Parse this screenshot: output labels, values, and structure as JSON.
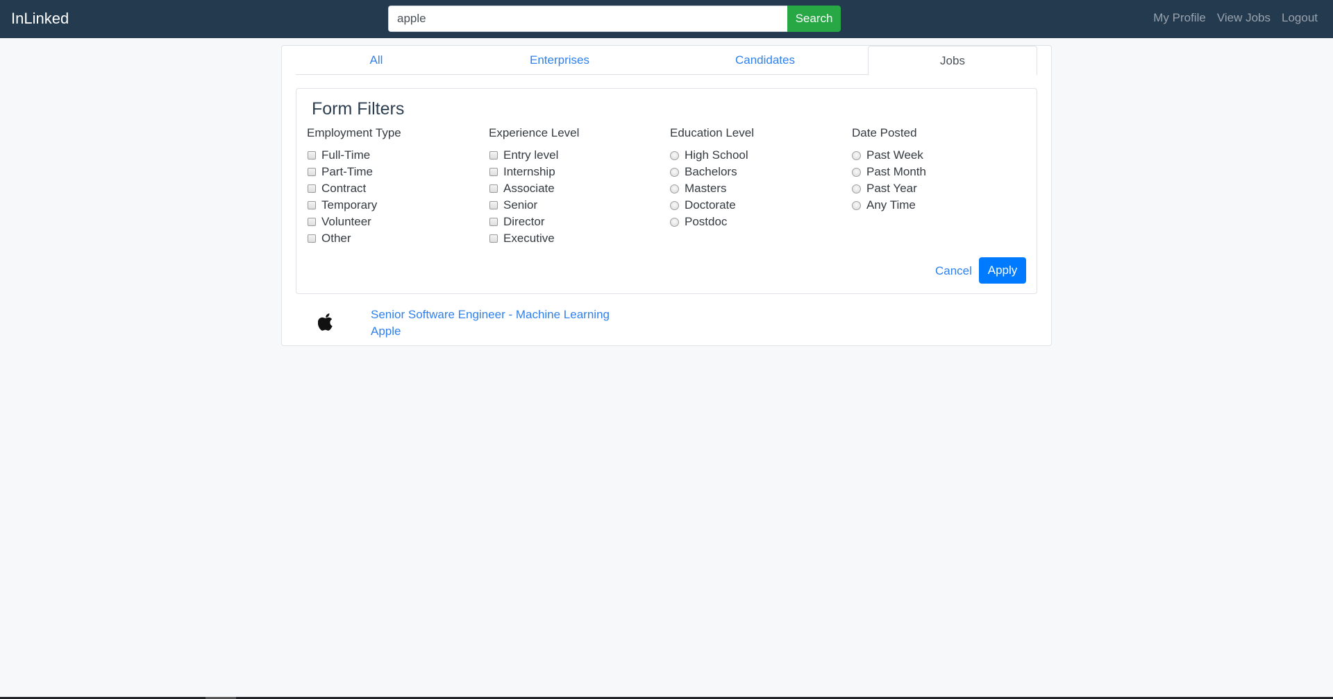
{
  "navbar": {
    "brand": "InLinked",
    "search": {
      "value": "apple",
      "placeholder": "",
      "button_label": "Search"
    },
    "links": [
      "My Profile",
      "View Jobs",
      "Logout"
    ]
  },
  "tabs": [
    {
      "label": "All",
      "active": false
    },
    {
      "label": "Enterprises",
      "active": false
    },
    {
      "label": "Candidates",
      "active": false
    },
    {
      "label": "Jobs",
      "active": true
    }
  ],
  "filters": {
    "title": "Form Filters",
    "groups": [
      {
        "label": "Employment Type",
        "input": "checkbox",
        "options": [
          "Full-Time",
          "Part-Time",
          "Contract",
          "Temporary",
          "Volunteer",
          "Other"
        ]
      },
      {
        "label": "Experience Level",
        "input": "checkbox",
        "options": [
          "Entry level",
          "Internship",
          "Associate",
          "Senior",
          "Director",
          "Executive"
        ]
      },
      {
        "label": "Education Level",
        "input": "radio",
        "options": [
          "High School",
          "Bachelors",
          "Masters",
          "Doctorate",
          "Postdoc"
        ]
      },
      {
        "label": "Date Posted",
        "input": "radio",
        "options": [
          "Past Week",
          "Past Month",
          "Past Year",
          "Any Time"
        ]
      }
    ],
    "cancel_label": "Cancel",
    "apply_label": "Apply"
  },
  "results": [
    {
      "logo": "apple-logo-icon",
      "title": "Senior Software Engineer - Machine Learning",
      "company": "Apple"
    }
  ],
  "colors": {
    "navbar": "#233a4f",
    "search_button": "#28a745",
    "apply_button": "#007bff",
    "link": "#2f80ed"
  }
}
